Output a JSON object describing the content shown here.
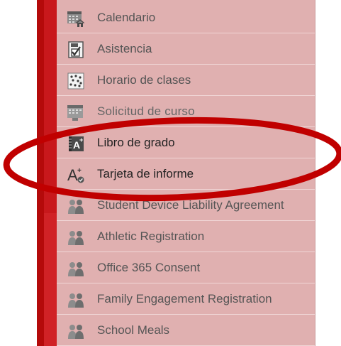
{
  "colors": {
    "menu_background": "#e0b0b0",
    "sidebar_red": "#c8181c",
    "annotation_red": "#c00000",
    "text": "#555555"
  },
  "menu": {
    "items": [
      {
        "label": "Calendario",
        "icon": "calendar-icon"
      },
      {
        "label": "Asistencia",
        "icon": "attendance-checkbox-icon"
      },
      {
        "label": "Horario de clases",
        "icon": "class-schedule-icon"
      },
      {
        "label": "Solicitud de curso",
        "icon": "course-request-icon"
      },
      {
        "label": "Libro de grado",
        "icon": "gradebook-icon"
      },
      {
        "label": "Tarjeta de informe",
        "icon": "report-card-icon"
      },
      {
        "label": "Student Device Liability Agreement",
        "icon": "people-icon"
      },
      {
        "label": "Athletic Registration",
        "icon": "people-icon"
      },
      {
        "label": "Office 365 Consent",
        "icon": "people-icon"
      },
      {
        "label": "Family Engagement Registration",
        "icon": "people-icon"
      },
      {
        "label": "School Meals",
        "icon": "people-icon"
      }
    ]
  }
}
